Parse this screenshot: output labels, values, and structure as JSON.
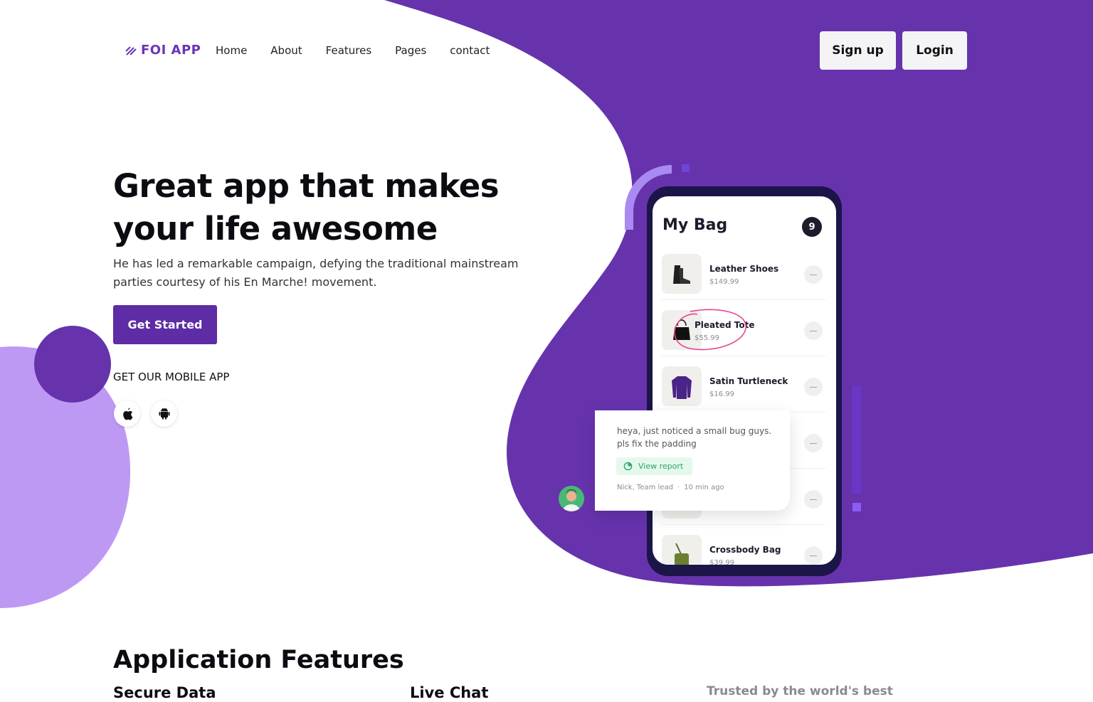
{
  "brand": {
    "name": "FOI APP",
    "primary_color": "#5e2ca5",
    "purple_bg": "#6633ad",
    "lilac": "#bd99f4"
  },
  "nav": {
    "items": [
      "Home",
      "About",
      "Features",
      "Pages",
      "contact"
    ]
  },
  "auth": {
    "signup": "Sign up",
    "login": "Login"
  },
  "hero": {
    "title_line1": "Great app that makes",
    "title_line2": "your life awesome",
    "subtitle": "He has led a remarkable campaign, defying the traditional mainstream parties courtesy of his En Marche! movement.",
    "cta": "Get Started",
    "mobile_label": "GET OUR MOBILE APP",
    "store_icons": [
      "apple-icon",
      "android-icon"
    ]
  },
  "bag": {
    "title": "My Bag",
    "count": "9",
    "items": [
      {
        "name": "Leather Shoes",
        "price": "$149.99",
        "icon": "boot-icon"
      },
      {
        "name": "Pleated Tote",
        "price": "$55.99",
        "icon": "tote-bag-icon"
      },
      {
        "name": "Satin Turtleneck",
        "price": "$16.99",
        "icon": "sweater-icon"
      },
      {
        "name": "",
        "price": "",
        "icon": ""
      },
      {
        "name": "",
        "price": "",
        "icon": ""
      },
      {
        "name": "Crossbody Bag",
        "price": "$39.99",
        "icon": "crossbody-bag-icon"
      }
    ]
  },
  "comment": {
    "text": "heya, just noticed a small bug guys. pls fix the padding",
    "action": "View report",
    "author": "Nick",
    "role": "Team lead",
    "time": "10 min ago"
  },
  "features": {
    "title": "Application Features",
    "col1": "Secure Data",
    "col2": "Live Chat",
    "trusted": "Trusted by the world's best"
  }
}
